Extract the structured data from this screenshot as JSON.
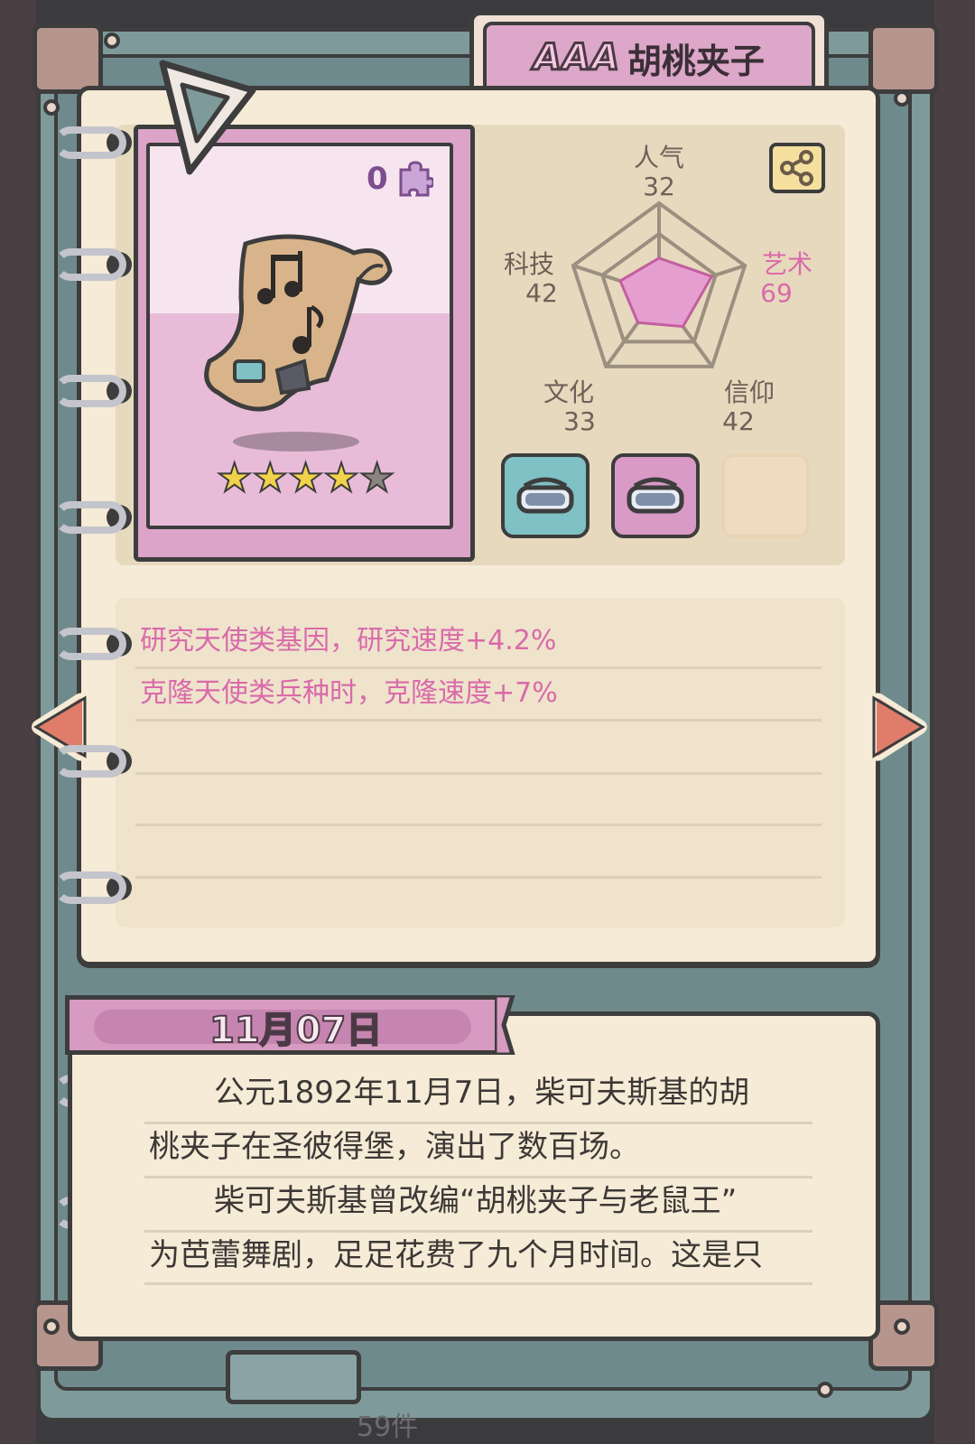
{
  "item": {
    "rank": "AAA",
    "name": "胡桃夹子",
    "count": "0",
    "stars_total": 5,
    "stars_filled": 4
  },
  "stats": {
    "popularity": {
      "label": "人气",
      "value": "32"
    },
    "art": {
      "label": "艺术",
      "value": "69"
    },
    "faith": {
      "label": "信仰",
      "value": "42"
    },
    "culture": {
      "label": "文化",
      "value": "33"
    },
    "tech": {
      "label": "科技",
      "value": "42"
    }
  },
  "effects": [
    "研究天使类基因，研究速度+4.2%",
    "克隆天使类兵种时，克隆速度+7%"
  ],
  "slots": [
    {
      "state": "filled",
      "color": "#7fc1c4",
      "icon": "vr-headset-icon"
    },
    {
      "state": "filled",
      "color": "#d99ac6",
      "icon": "vr-headset-icon"
    },
    {
      "state": "empty",
      "color": "#efdcc0",
      "icon": ""
    }
  ],
  "story": {
    "date": "11月07日",
    "lines": [
      "公元1892年11月7日，柴可夫斯基的胡",
      "桃夹子在圣彼得堡，演出了数百场。",
      "柴可夫斯基曾改编“胡桃夹子与老鼠王”",
      "为芭蕾舞剧，足足花费了九个月时间。这是只"
    ]
  },
  "footer": {
    "count_text": "59件"
  },
  "colors": {
    "accent_pink": "#d96aa9",
    "card_bg": "#f5ebd6",
    "frame": "#7f9a9b",
    "star": "#f2d24b",
    "arrow": "#e07d6a"
  }
}
